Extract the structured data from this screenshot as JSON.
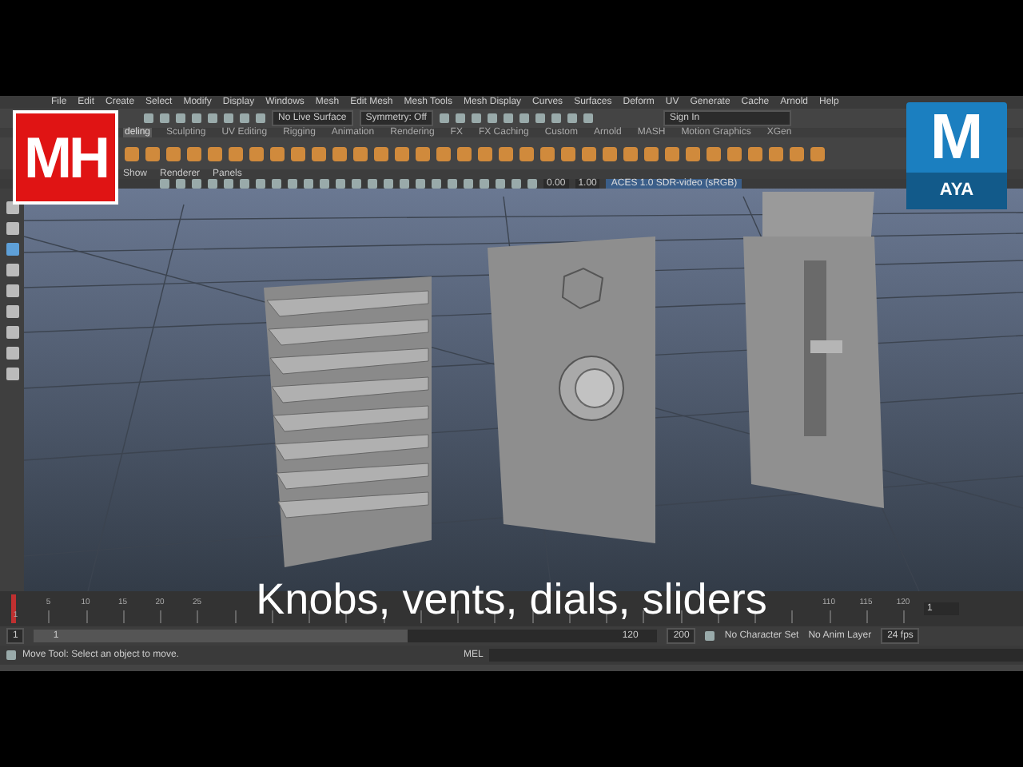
{
  "menu_bar": {
    "items": [
      "File",
      "Edit",
      "Create",
      "Select",
      "Modify",
      "Display",
      "Windows",
      "Mesh",
      "Edit Mesh",
      "Mesh Tools",
      "Mesh Display",
      "Curves",
      "Surfaces",
      "Deform",
      "UV",
      "Generate",
      "Cache",
      "Arnold",
      "Help"
    ]
  },
  "status_line": {
    "live_surface": "No Live Surface",
    "symmetry": "Symmetry: Off",
    "sign_in": "Sign In"
  },
  "shelf": {
    "tabs": [
      {
        "label": "deling",
        "selected": true
      },
      {
        "label": "Sculpting",
        "selected": false
      },
      {
        "label": "UV Editing",
        "selected": false
      },
      {
        "label": "Rigging",
        "selected": false
      },
      {
        "label": "Animation",
        "selected": false
      },
      {
        "label": "Rendering",
        "selected": false
      },
      {
        "label": "FX",
        "selected": false
      },
      {
        "label": "FX Caching",
        "selected": false
      },
      {
        "label": "Custom",
        "selected": false
      },
      {
        "label": "Arnold",
        "selected": false
      },
      {
        "label": "MASH",
        "selected": false
      },
      {
        "label": "Motion Graphics",
        "selected": false
      },
      {
        "label": "XGen",
        "selected": false
      }
    ]
  },
  "panel_menu": [
    "Show",
    "Renderer",
    "Panels"
  ],
  "panel_toolbar": {
    "exposure": "0.00",
    "gamma": "1.00",
    "color_space": "ACES 1.0 SDR-video (sRGB)"
  },
  "timeline": {
    "level": 0,
    "ticks": [
      "5",
      "10",
      "15",
      "20",
      "25",
      "110",
      "115",
      "120"
    ],
    "start_label": "1",
    "current_frame": "1"
  },
  "range_slider": {
    "level": 0.6,
    "start": "1",
    "range_start": "1",
    "range_end": "120",
    "end": "200",
    "character_set": "No Character Set",
    "anim_layer": "No Anim Layer",
    "fps": "24 fps"
  },
  "help_line": "Move Tool: Select an object to move.",
  "command_line": {
    "label": "MEL"
  },
  "overlay": {
    "channel_logo": "MH",
    "app_logo": {
      "letter": "M",
      "word": "AYA"
    },
    "subtitle": "Knobs, vents, dials, sliders"
  }
}
